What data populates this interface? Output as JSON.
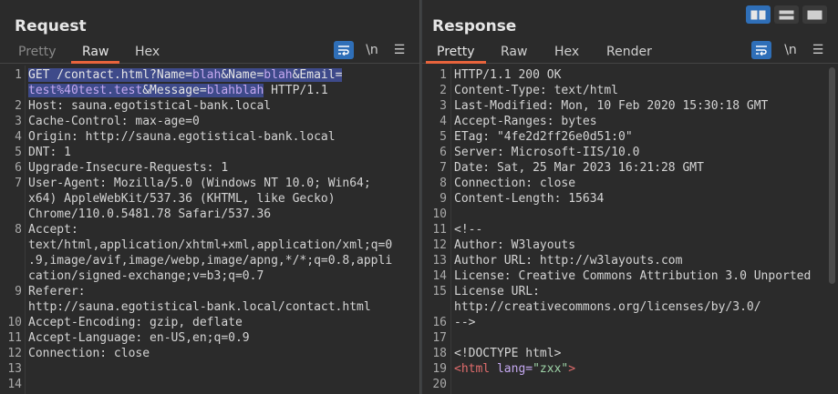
{
  "request": {
    "title": "Request",
    "tabs": [
      "Pretty",
      "Raw",
      "Hex"
    ],
    "active_tab": "Raw",
    "newline_toggle": "\\n",
    "menu_glyph": "☰",
    "lines": [
      {
        "n": "1",
        "segments": [
          {
            "t": "GET /contact.html?Name=",
            "c": "hl"
          },
          {
            "t": "blah",
            "c": "hl-val"
          },
          {
            "t": "&Name=",
            "c": "hl"
          },
          {
            "t": "blah",
            "c": "hl-val"
          },
          {
            "t": "&Email=",
            "c": "hl"
          }
        ]
      },
      {
        "n": "",
        "segments": [
          {
            "t": "test%40test.test",
            "c": "hl-val"
          },
          {
            "t": "&Message=",
            "c": "hl"
          },
          {
            "t": "blahblah",
            "c": "hl-val"
          },
          {
            "t": " HTTP/1.1",
            "c": ""
          }
        ]
      },
      {
        "n": "2",
        "segments": [
          {
            "t": "Host: sauna.egotistical-bank.local",
            "c": ""
          }
        ]
      },
      {
        "n": "3",
        "segments": [
          {
            "t": "Cache-Control: max-age=0",
            "c": ""
          }
        ]
      },
      {
        "n": "4",
        "segments": [
          {
            "t": "Origin: http://sauna.egotistical-bank.local",
            "c": ""
          }
        ]
      },
      {
        "n": "5",
        "segments": [
          {
            "t": "DNT: 1",
            "c": ""
          }
        ]
      },
      {
        "n": "6",
        "segments": [
          {
            "t": "Upgrade-Insecure-Requests: 1",
            "c": ""
          }
        ]
      },
      {
        "n": "7",
        "segments": [
          {
            "t": "User-Agent: Mozilla/5.0 (Windows NT 10.0; Win64;",
            "c": ""
          }
        ]
      },
      {
        "n": "",
        "segments": [
          {
            "t": "x64) AppleWebKit/537.36 (KHTML, like Gecko)",
            "c": ""
          }
        ]
      },
      {
        "n": "",
        "segments": [
          {
            "t": "Chrome/110.0.5481.78 Safari/537.36",
            "c": ""
          }
        ]
      },
      {
        "n": "8",
        "segments": [
          {
            "t": "Accept:",
            "c": ""
          }
        ]
      },
      {
        "n": "",
        "segments": [
          {
            "t": "text/html,application/xhtml+xml,application/xml;q=0",
            "c": ""
          }
        ]
      },
      {
        "n": "",
        "segments": [
          {
            "t": ".9,image/avif,image/webp,image/apng,*/*;q=0.8,appli",
            "c": ""
          }
        ]
      },
      {
        "n": "",
        "segments": [
          {
            "t": "cation/signed-exchange;v=b3;q=0.7",
            "c": ""
          }
        ]
      },
      {
        "n": "9",
        "segments": [
          {
            "t": "Referer:",
            "c": ""
          }
        ]
      },
      {
        "n": "",
        "segments": [
          {
            "t": "http://sauna.egotistical-bank.local/contact.html",
            "c": ""
          }
        ]
      },
      {
        "n": "10",
        "segments": [
          {
            "t": "Accept-Encoding: gzip, deflate",
            "c": ""
          }
        ]
      },
      {
        "n": "11",
        "segments": [
          {
            "t": "Accept-Language: en-US,en;q=0.9",
            "c": ""
          }
        ]
      },
      {
        "n": "12",
        "segments": [
          {
            "t": "Connection: close",
            "c": ""
          }
        ]
      },
      {
        "n": "13",
        "segments": [
          {
            "t": "",
            "c": ""
          }
        ]
      },
      {
        "n": "14",
        "segments": [
          {
            "t": "",
            "c": ""
          }
        ]
      }
    ]
  },
  "response": {
    "title": "Response",
    "tabs": [
      "Pretty",
      "Raw",
      "Hex",
      "Render"
    ],
    "active_tab": "Pretty",
    "newline_toggle": "\\n",
    "menu_glyph": "☰",
    "lines": [
      {
        "n": "1",
        "segments": [
          {
            "t": "HTTP/1.1 200 OK",
            "c": ""
          }
        ]
      },
      {
        "n": "2",
        "segments": [
          {
            "t": "Content-Type: text/html",
            "c": ""
          }
        ]
      },
      {
        "n": "3",
        "segments": [
          {
            "t": "Last-Modified: Mon, 10 Feb 2020 15:30:18 GMT",
            "c": ""
          }
        ]
      },
      {
        "n": "4",
        "segments": [
          {
            "t": "Accept-Ranges: bytes",
            "c": ""
          }
        ]
      },
      {
        "n": "5",
        "segments": [
          {
            "t": "ETag: \"4fe2d2ff26e0d51:0\"",
            "c": ""
          }
        ]
      },
      {
        "n": "6",
        "segments": [
          {
            "t": "Server: Microsoft-IIS/10.0",
            "c": ""
          }
        ]
      },
      {
        "n": "7",
        "segments": [
          {
            "t": "Date: Sat, 25 Mar 2023 16:21:28 GMT",
            "c": ""
          }
        ]
      },
      {
        "n": "8",
        "segments": [
          {
            "t": "Connection: close",
            "c": ""
          }
        ]
      },
      {
        "n": "9",
        "segments": [
          {
            "t": "Content-Length: 15634",
            "c": ""
          }
        ]
      },
      {
        "n": "10",
        "segments": [
          {
            "t": "",
            "c": ""
          }
        ]
      },
      {
        "n": "11",
        "segments": [
          {
            "t": "<!--",
            "c": ""
          }
        ]
      },
      {
        "n": "12",
        "segments": [
          {
            "t": "Author: W3layouts",
            "c": ""
          }
        ]
      },
      {
        "n": "13",
        "segments": [
          {
            "t": "Author URL: http://w3layouts.com",
            "c": ""
          }
        ]
      },
      {
        "n": "14",
        "segments": [
          {
            "t": "License: Creative Commons Attribution 3.0 Unported",
            "c": ""
          }
        ]
      },
      {
        "n": "15",
        "segments": [
          {
            "t": "License URL:",
            "c": ""
          }
        ]
      },
      {
        "n": "",
        "segments": [
          {
            "t": "http://creativecommons.org/licenses/by/3.0/",
            "c": ""
          }
        ]
      },
      {
        "n": "16",
        "segments": [
          {
            "t": "-->",
            "c": ""
          }
        ]
      },
      {
        "n": "17",
        "segments": [
          {
            "t": "",
            "c": ""
          }
        ]
      },
      {
        "n": "18",
        "segments": [
          {
            "t": "<!DOCTYPE html>",
            "c": ""
          }
        ]
      },
      {
        "n": "19",
        "segments": [
          {
            "t": "<html",
            "c": "tagc"
          },
          {
            "t": " lang=",
            "c": "attr"
          },
          {
            "t": "\"zxx\"",
            "c": "str"
          },
          {
            "t": ">",
            "c": "tagc"
          }
        ]
      },
      {
        "n": "20",
        "segments": [
          {
            "t": "",
            "c": ""
          }
        ]
      }
    ]
  },
  "layout_switch": [
    "side-by-side",
    "top-bottom",
    "tabs"
  ],
  "colors": {
    "background": "#2b2b2b",
    "highlight": "#3e4a8a",
    "accent": "#e8643c",
    "button_blue": "#2f6fb8"
  }
}
